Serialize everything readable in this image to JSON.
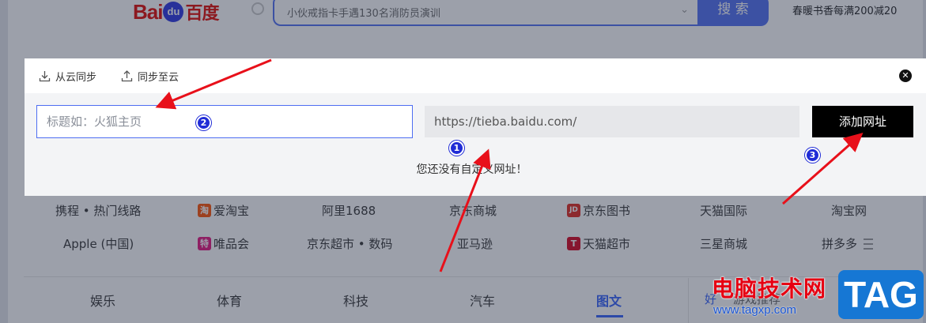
{
  "header": {
    "logo": {
      "bai": "Bai",
      "du": "du",
      "cn": "百度"
    },
    "search_query": "小伙戒指卡手遇130名消防员演训",
    "search_button": "搜 索",
    "promo": "春暖书香每满200减20"
  },
  "links": {
    "row1": [
      {
        "label": "携程 • 热门线路",
        "badge": ""
      },
      {
        "label": "爱淘宝",
        "badge": "淘"
      },
      {
        "label": "阿里1688",
        "badge": ""
      },
      {
        "label": "京东商城",
        "badge": ""
      },
      {
        "label": "京东图书",
        "badge": "JD"
      },
      {
        "label": "天猫国际",
        "badge": ""
      },
      {
        "label": "淘宝网",
        "badge": ""
      }
    ],
    "row2": [
      {
        "label": "Apple (中国)",
        "badge": ""
      },
      {
        "label": "唯品会",
        "badge": "特"
      },
      {
        "label": "京东超市 • 数码",
        "badge": ""
      },
      {
        "label": "亚马逊",
        "badge": ""
      },
      {
        "label": "天猫超市",
        "badge": "T"
      },
      {
        "label": "三星商城",
        "badge": ""
      },
      {
        "label": "拼多多",
        "badge": ""
      }
    ]
  },
  "news_tabs": [
    {
      "label": "娱乐",
      "active": false
    },
    {
      "label": "体育",
      "active": false
    },
    {
      "label": "科技",
      "active": false
    },
    {
      "label": "汽车",
      "active": false
    },
    {
      "label": "图文",
      "active": true
    }
  ],
  "side_panel": {
    "left": "好",
    "right": "游戏推荐"
  },
  "modal": {
    "sync_from_cloud": "从云同步",
    "sync_to_cloud": "同步至云",
    "close_glyph": "✕",
    "title_placeholder": "标题如：火狐主页",
    "url_placeholder": "https://tieba.baidu.com/",
    "add_button": "添加网址",
    "empty_message": "您还没有自定义网址！"
  },
  "annotations": {
    "markers": [
      "1",
      "2",
      "3"
    ],
    "arrow_color": "#e8101a"
  },
  "watermark": {
    "cn": "电脑技术网",
    "url": "www.tagxp.com",
    "tag": "TAG"
  }
}
